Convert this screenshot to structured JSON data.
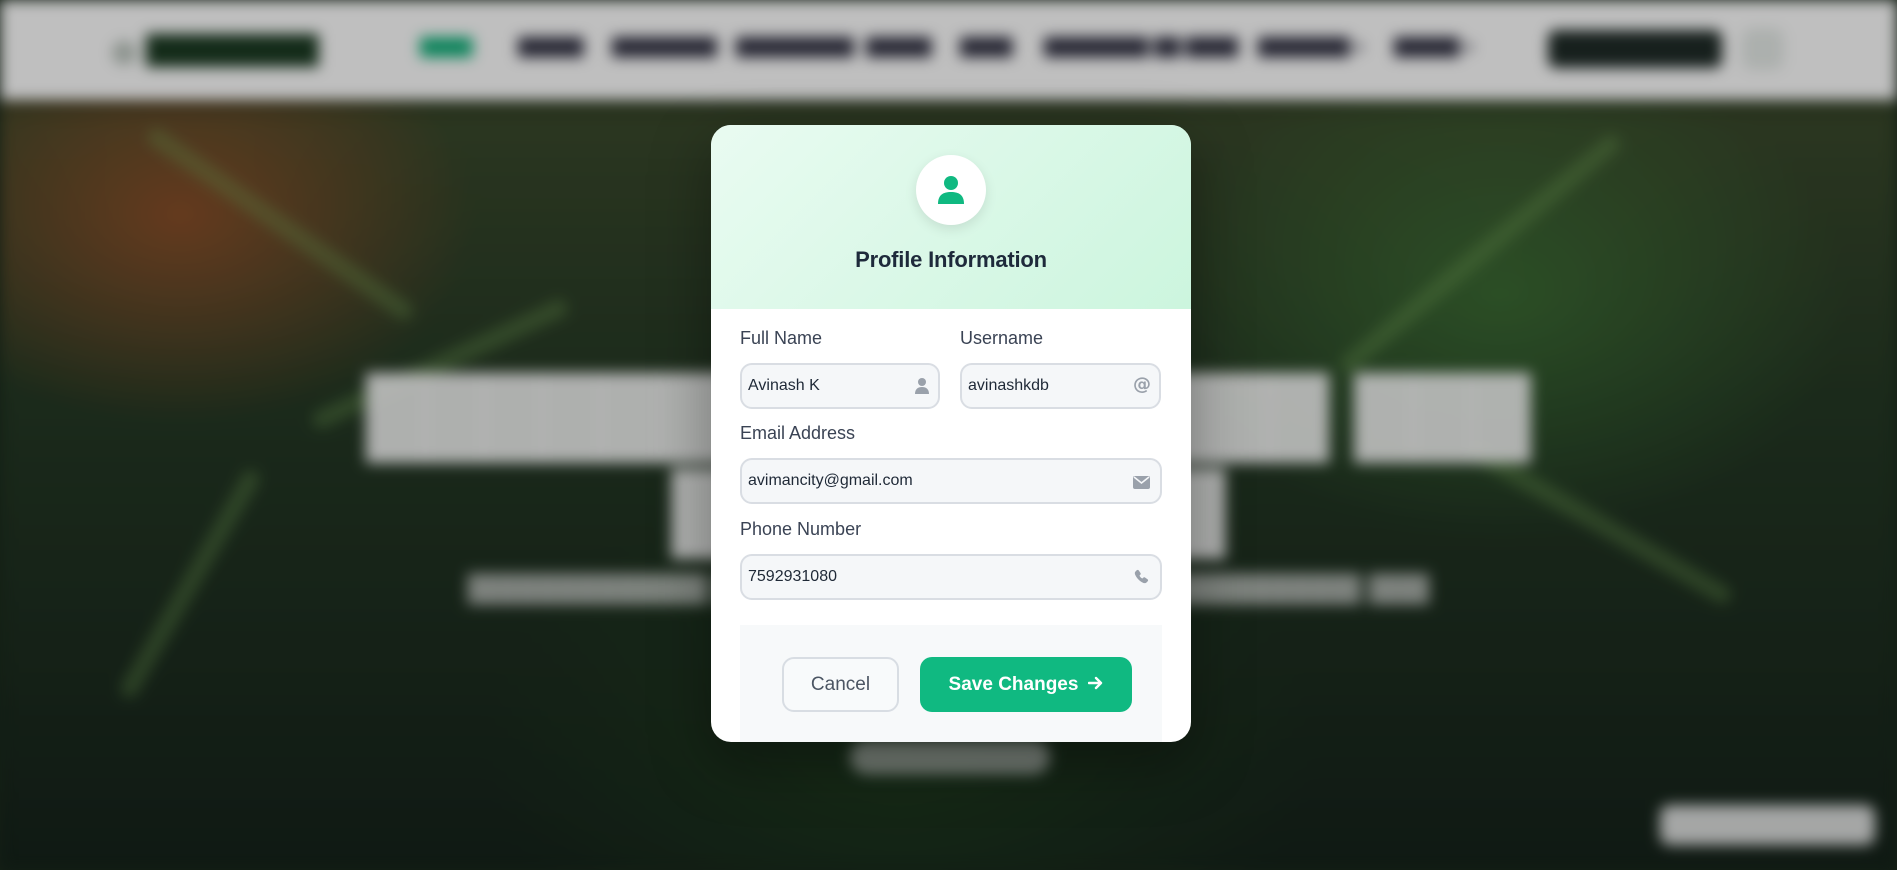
{
  "modal": {
    "title": "Profile Information",
    "fields": {
      "full_name": {
        "label": "Full Name",
        "value": "Avinash K",
        "icon": "user-icon"
      },
      "username": {
        "label": "Username",
        "value": "avinashkdb",
        "icon": "at-icon"
      },
      "email": {
        "label": "Email Address",
        "value": "avimancity@gmail.com",
        "icon": "envelope-icon"
      },
      "phone": {
        "label": "Phone Number",
        "value": "7592931080",
        "icon": "phone-icon"
      }
    },
    "buttons": {
      "cancel_label": "Cancel",
      "save_label": "Save Changes"
    }
  },
  "colors": {
    "accent": "#10b981",
    "header_gradient_start": "#e9fbf1",
    "header_gradient_end": "#ccf5de",
    "title": "#1e2a3b"
  }
}
